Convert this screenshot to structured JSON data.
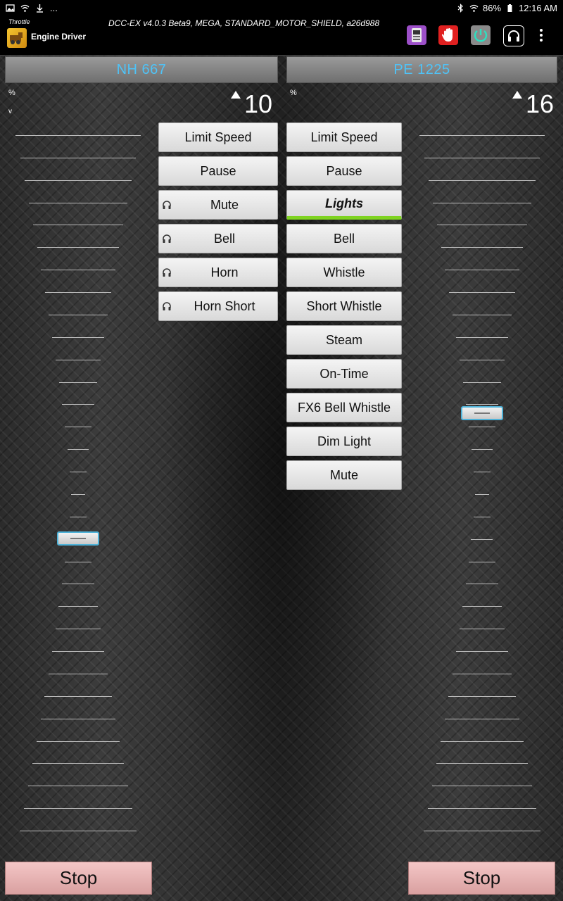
{
  "status_bar": {
    "left_icons": [
      "image-icon",
      "wifi-icon",
      "download-icon",
      "more-notifications-icon"
    ],
    "more": "...",
    "bluetooth": "bluetooth-icon",
    "battery": "86%",
    "time": "12:16 AM"
  },
  "app_bar": {
    "small_title": "Throttle",
    "app_name": "Engine Driver",
    "server_info": "DCC-EX v4.0.3 Beta9, MEGA, STANDARD_MOTOR_SHIELD, a26d988",
    "actions": [
      "layout-icon",
      "emergency-stop-hand-icon",
      "power-icon",
      "headset-icon",
      "overflow-menu-icon"
    ]
  },
  "throttles": [
    {
      "loco": "NH 667",
      "speed_unit": "%",
      "direction_label": "v",
      "speed": "10",
      "slider_position": 0.42,
      "stop_label": "Stop",
      "functions": [
        {
          "label": "Limit Speed",
          "headset": false,
          "active": false
        },
        {
          "label": "Pause",
          "headset": false,
          "active": false
        },
        {
          "label": "Mute",
          "headset": true,
          "active": false
        },
        {
          "label": "Bell",
          "headset": true,
          "active": false
        },
        {
          "label": "Horn",
          "headset": true,
          "active": false
        },
        {
          "label": "Horn Short",
          "headset": true,
          "active": false
        }
      ]
    },
    {
      "loco": "PE 1225",
      "speed_unit": "%",
      "speed": "16",
      "slider_position": 0.6,
      "stop_label": "Stop",
      "functions": [
        {
          "label": "Limit Speed",
          "active": false
        },
        {
          "label": "Pause",
          "active": false
        },
        {
          "label": "Lights",
          "active": true
        },
        {
          "label": "Bell",
          "active": false
        },
        {
          "label": "Whistle",
          "active": false
        },
        {
          "label": "Short Whistle",
          "active": false
        },
        {
          "label": "Steam",
          "active": false
        },
        {
          "label": "On-Time",
          "active": false
        },
        {
          "label": "FX6 Bell Whistle",
          "active": false
        },
        {
          "label": "Dim Light",
          "active": false
        },
        {
          "label": "Mute",
          "active": false
        }
      ]
    }
  ],
  "colors": {
    "loco_label": "#4fc3f7",
    "active_function_bar": "#7ed321",
    "stop_button": "#e8b4b4"
  }
}
